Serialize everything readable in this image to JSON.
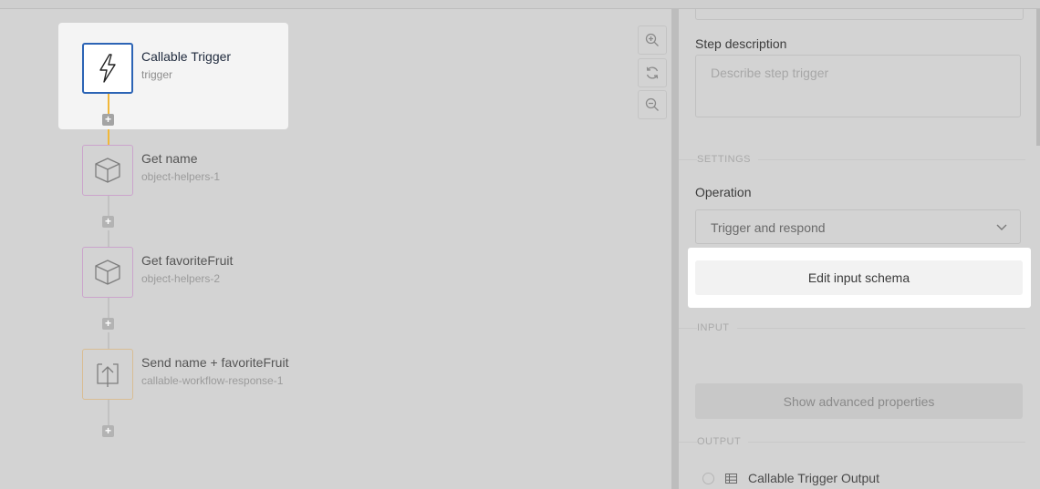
{
  "canvas": {
    "nodes": [
      {
        "title": "Callable Trigger",
        "subtitle": "trigger",
        "icon": "lightning-icon"
      },
      {
        "title": "Get name",
        "subtitle": "object-helpers-1",
        "icon": "cube-icon"
      },
      {
        "title": "Get favoriteFruit",
        "subtitle": "object-helpers-2",
        "icon": "cube-icon"
      },
      {
        "title": "Send name + favoriteFruit",
        "subtitle": "callable-workflow-response-1",
        "icon": "upload-arrow-icon"
      }
    ],
    "add_symbol": "+",
    "zoom_controls": [
      "zoom-in-icon",
      "refresh-icon",
      "zoom-out-icon"
    ]
  },
  "panel": {
    "step_description_label": "Step description",
    "step_description_placeholder": "Describe step trigger",
    "settings_section": "SETTINGS",
    "operation_label": "Operation",
    "operation_value": "Trigger and respond",
    "edit_schema_button": "Edit input schema",
    "input_section": "INPUT",
    "show_advanced_button": "Show advanced properties",
    "output_section": "OUTPUT",
    "output_item": "Callable Trigger Output"
  },
  "colors": {
    "trigger_border": "#2c64b5",
    "connector_active": "#f1b739",
    "overlay": "#d3d3d3"
  }
}
